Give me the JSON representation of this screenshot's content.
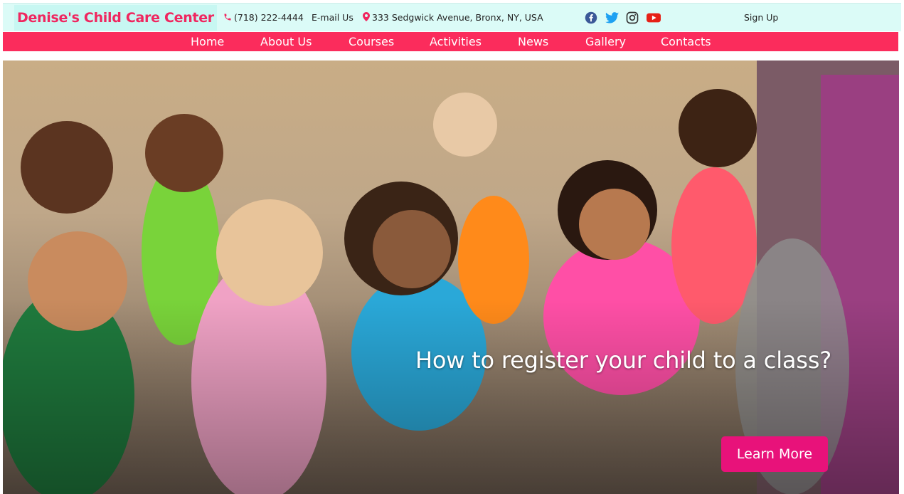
{
  "header": {
    "brand": "Denise's Child Care Center",
    "phone": "(718) 222-4444",
    "email_label": "E-mail Us",
    "address": "333 Sedgwick Avenue, Bronx, NY, USA",
    "social": [
      "facebook-icon",
      "twitter-icon",
      "instagram-icon",
      "youtube-icon"
    ],
    "signup_label": "Sign Up"
  },
  "nav": {
    "items": [
      {
        "label": "Home"
      },
      {
        "label": "About Us"
      },
      {
        "label": "Courses"
      },
      {
        "label": "Activities"
      },
      {
        "label": "News"
      },
      {
        "label": "Gallery"
      },
      {
        "label": "Contacts"
      }
    ]
  },
  "hero": {
    "headline": "How to register your child to a class?",
    "cta_label": "Learn More"
  },
  "colors": {
    "brand": "#f0265f",
    "nav_bg": "#fb2c5c",
    "topbar_bg": "#dbfbf7",
    "cta_bg": "#e8127a",
    "facebook": "#3b5998",
    "twitter": "#1da1f2",
    "instagram": "#333333",
    "youtube": "#e62117"
  }
}
